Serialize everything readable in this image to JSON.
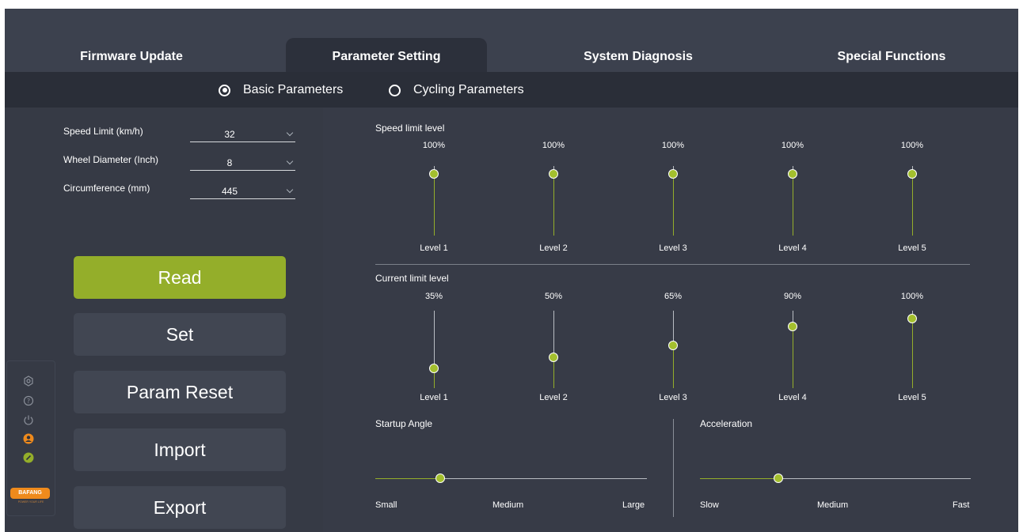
{
  "tabs": [
    {
      "label": "Firmware Update",
      "active": false
    },
    {
      "label": "Parameter Setting",
      "active": true
    },
    {
      "label": "System Diagnosis",
      "active": false
    },
    {
      "label": "Special Functions",
      "active": false
    }
  ],
  "subtabs": [
    {
      "label": "Basic Parameters",
      "checked": true
    },
    {
      "label": "Cycling Parameters",
      "checked": false
    }
  ],
  "params": [
    {
      "label": "Speed Limit (km/h)",
      "value": "32"
    },
    {
      "label": "Wheel Diameter (Inch)",
      "value": "8"
    },
    {
      "label": "Circumference (mm)",
      "value": "445"
    }
  ],
  "buttons": {
    "read": "Read",
    "set": "Set",
    "param_reset": "Param Reset",
    "import": "Import",
    "export": "Export"
  },
  "side_icons": [
    "settings-icon",
    "help-icon",
    "power-icon",
    "user-icon",
    "link-icon"
  ],
  "brand": {
    "logo_text": "BAFANG",
    "tagline": "POWER YOUR LIFE"
  },
  "speed_limit": {
    "title": "Speed limit level",
    "levels": [
      {
        "label": "Level 1",
        "percent_text": "100%",
        "value": 100
      },
      {
        "label": "Level 2",
        "percent_text": "100%",
        "value": 100
      },
      {
        "label": "Level 3",
        "percent_text": "100%",
        "value": 100
      },
      {
        "label": "Level 4",
        "percent_text": "100%",
        "value": 100
      },
      {
        "label": "Level 5",
        "percent_text": "100%",
        "value": 100
      }
    ]
  },
  "current_limit": {
    "title": "Current limit level",
    "levels": [
      {
        "label": "Level 1",
        "percent_text": "35%",
        "value": 35
      },
      {
        "label": "Level 2",
        "percent_text": "50%",
        "value": 50
      },
      {
        "label": "Level 3",
        "percent_text": "65%",
        "value": 65
      },
      {
        "label": "Level 4",
        "percent_text": "90%",
        "value": 90
      },
      {
        "label": "Level 5",
        "percent_text": "100%",
        "value": 100
      }
    ]
  },
  "startup_angle": {
    "title": "Startup Angle",
    "labels": [
      "Small",
      "Medium",
      "Large"
    ],
    "fraction": 0.24
  },
  "acceleration": {
    "title": "Acceleration",
    "labels": [
      "Slow",
      "Medium",
      "Fast"
    ],
    "fraction": 0.29
  },
  "colors": {
    "accent": "#94ae2a",
    "knob": "#a3bf2e",
    "panel": "#373b47",
    "button": "#414652",
    "brand": "#ef8a1c"
  }
}
